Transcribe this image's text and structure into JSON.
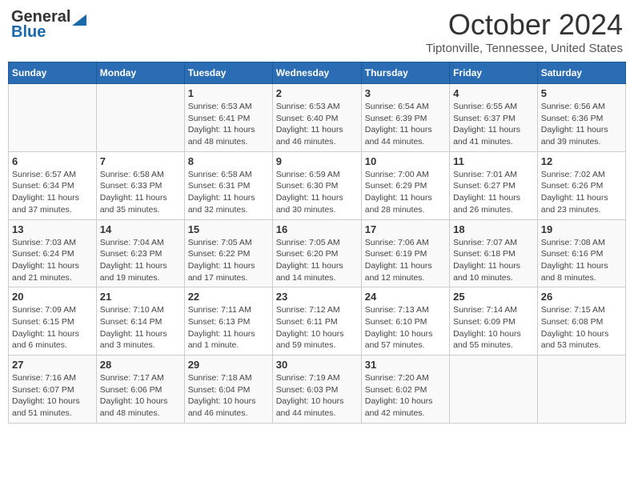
{
  "header": {
    "logo_line1": "General",
    "logo_line2": "Blue",
    "month": "October 2024",
    "location": "Tiptonville, Tennessee, United States"
  },
  "days_of_week": [
    "Sunday",
    "Monday",
    "Tuesday",
    "Wednesday",
    "Thursday",
    "Friday",
    "Saturday"
  ],
  "weeks": [
    [
      {
        "day": "",
        "info": ""
      },
      {
        "day": "",
        "info": ""
      },
      {
        "day": "1",
        "info": "Sunrise: 6:53 AM\nSunset: 6:41 PM\nDaylight: 11 hours and 48 minutes."
      },
      {
        "day": "2",
        "info": "Sunrise: 6:53 AM\nSunset: 6:40 PM\nDaylight: 11 hours and 46 minutes."
      },
      {
        "day": "3",
        "info": "Sunrise: 6:54 AM\nSunset: 6:39 PM\nDaylight: 11 hours and 44 minutes."
      },
      {
        "day": "4",
        "info": "Sunrise: 6:55 AM\nSunset: 6:37 PM\nDaylight: 11 hours and 41 minutes."
      },
      {
        "day": "5",
        "info": "Sunrise: 6:56 AM\nSunset: 6:36 PM\nDaylight: 11 hours and 39 minutes."
      }
    ],
    [
      {
        "day": "6",
        "info": "Sunrise: 6:57 AM\nSunset: 6:34 PM\nDaylight: 11 hours and 37 minutes."
      },
      {
        "day": "7",
        "info": "Sunrise: 6:58 AM\nSunset: 6:33 PM\nDaylight: 11 hours and 35 minutes."
      },
      {
        "day": "8",
        "info": "Sunrise: 6:58 AM\nSunset: 6:31 PM\nDaylight: 11 hours and 32 minutes."
      },
      {
        "day": "9",
        "info": "Sunrise: 6:59 AM\nSunset: 6:30 PM\nDaylight: 11 hours and 30 minutes."
      },
      {
        "day": "10",
        "info": "Sunrise: 7:00 AM\nSunset: 6:29 PM\nDaylight: 11 hours and 28 minutes."
      },
      {
        "day": "11",
        "info": "Sunrise: 7:01 AM\nSunset: 6:27 PM\nDaylight: 11 hours and 26 minutes."
      },
      {
        "day": "12",
        "info": "Sunrise: 7:02 AM\nSunset: 6:26 PM\nDaylight: 11 hours and 23 minutes."
      }
    ],
    [
      {
        "day": "13",
        "info": "Sunrise: 7:03 AM\nSunset: 6:24 PM\nDaylight: 11 hours and 21 minutes."
      },
      {
        "day": "14",
        "info": "Sunrise: 7:04 AM\nSunset: 6:23 PM\nDaylight: 11 hours and 19 minutes."
      },
      {
        "day": "15",
        "info": "Sunrise: 7:05 AM\nSunset: 6:22 PM\nDaylight: 11 hours and 17 minutes."
      },
      {
        "day": "16",
        "info": "Sunrise: 7:05 AM\nSunset: 6:20 PM\nDaylight: 11 hours and 14 minutes."
      },
      {
        "day": "17",
        "info": "Sunrise: 7:06 AM\nSunset: 6:19 PM\nDaylight: 11 hours and 12 minutes."
      },
      {
        "day": "18",
        "info": "Sunrise: 7:07 AM\nSunset: 6:18 PM\nDaylight: 11 hours and 10 minutes."
      },
      {
        "day": "19",
        "info": "Sunrise: 7:08 AM\nSunset: 6:16 PM\nDaylight: 11 hours and 8 minutes."
      }
    ],
    [
      {
        "day": "20",
        "info": "Sunrise: 7:09 AM\nSunset: 6:15 PM\nDaylight: 11 hours and 6 minutes."
      },
      {
        "day": "21",
        "info": "Sunrise: 7:10 AM\nSunset: 6:14 PM\nDaylight: 11 hours and 3 minutes."
      },
      {
        "day": "22",
        "info": "Sunrise: 7:11 AM\nSunset: 6:13 PM\nDaylight: 11 hours and 1 minute."
      },
      {
        "day": "23",
        "info": "Sunrise: 7:12 AM\nSunset: 6:11 PM\nDaylight: 10 hours and 59 minutes."
      },
      {
        "day": "24",
        "info": "Sunrise: 7:13 AM\nSunset: 6:10 PM\nDaylight: 10 hours and 57 minutes."
      },
      {
        "day": "25",
        "info": "Sunrise: 7:14 AM\nSunset: 6:09 PM\nDaylight: 10 hours and 55 minutes."
      },
      {
        "day": "26",
        "info": "Sunrise: 7:15 AM\nSunset: 6:08 PM\nDaylight: 10 hours and 53 minutes."
      }
    ],
    [
      {
        "day": "27",
        "info": "Sunrise: 7:16 AM\nSunset: 6:07 PM\nDaylight: 10 hours and 51 minutes."
      },
      {
        "day": "28",
        "info": "Sunrise: 7:17 AM\nSunset: 6:06 PM\nDaylight: 10 hours and 48 minutes."
      },
      {
        "day": "29",
        "info": "Sunrise: 7:18 AM\nSunset: 6:04 PM\nDaylight: 10 hours and 46 minutes."
      },
      {
        "day": "30",
        "info": "Sunrise: 7:19 AM\nSunset: 6:03 PM\nDaylight: 10 hours and 44 minutes."
      },
      {
        "day": "31",
        "info": "Sunrise: 7:20 AM\nSunset: 6:02 PM\nDaylight: 10 hours and 42 minutes."
      },
      {
        "day": "",
        "info": ""
      },
      {
        "day": "",
        "info": ""
      }
    ]
  ]
}
